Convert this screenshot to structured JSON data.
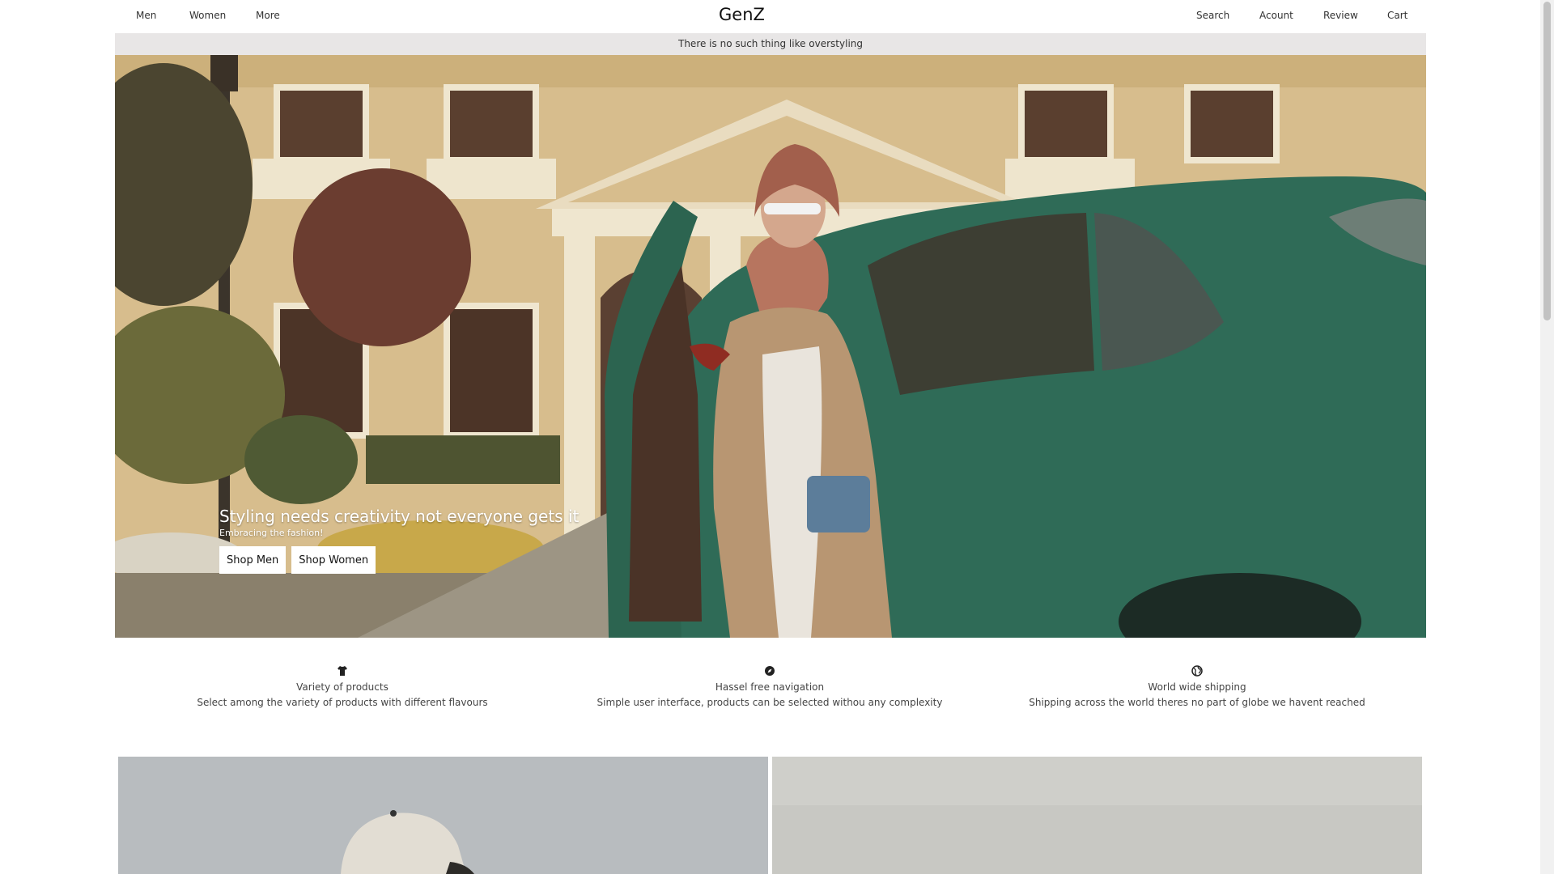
{
  "nav": {
    "left": [
      "Men",
      "Women",
      "More"
    ],
    "brand": "GenZ",
    "right": [
      "Search",
      "Acount",
      "Review",
      "Cart"
    ]
  },
  "announcement": "There is no such thing like overstyling",
  "hero": {
    "title": "Styling needs creativity not everyone gets it",
    "subtitle": "Embracing the fashion!",
    "buttons": [
      "Shop Men",
      "Shop Women"
    ]
  },
  "features": [
    {
      "icon": "tshirt-icon",
      "title": "Variety of products",
      "desc": "Select among the variety of products with different flavours"
    },
    {
      "icon": "compass-icon",
      "title": "Hassel free navigation",
      "desc": "Simple user interface, products can be selected withou any complexity"
    },
    {
      "icon": "globe-icon",
      "title": "World wide shipping",
      "desc": "Shipping across the world theres no part of globe we havent reached"
    }
  ],
  "colors": {
    "announce_bg": "#e8e6e6",
    "car_green": "#2f6b57",
    "building": "#d9bf8a"
  }
}
